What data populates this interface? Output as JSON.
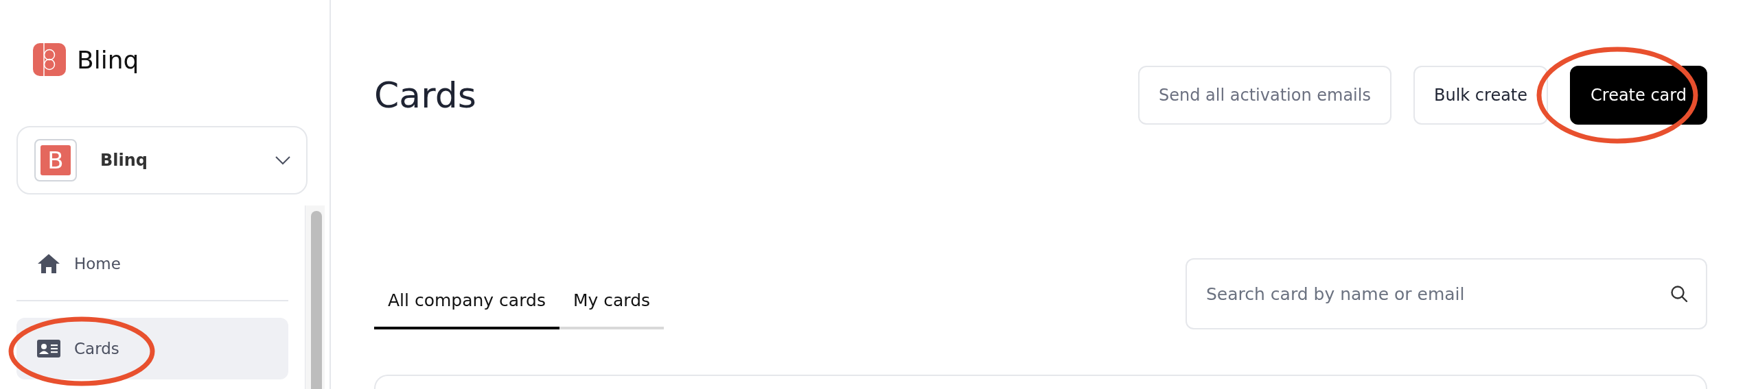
{
  "brand": {
    "name": "Blinq"
  },
  "workspace": {
    "name": "Blinq",
    "initial": "B"
  },
  "nav": [
    {
      "label": "Home",
      "kind": "home",
      "selected": false,
      "circled": false
    },
    {
      "label": "Cards",
      "kind": "cards",
      "selected": true,
      "circled": true
    }
  ],
  "page": {
    "title": "Cards"
  },
  "actions": [
    {
      "label": "Send all activation emails",
      "kind": "muted",
      "circled": false
    },
    {
      "label": "Bulk create",
      "kind": "outline",
      "circled": false
    },
    {
      "label": "Create card",
      "kind": "primary",
      "circled": true
    }
  ],
  "tabs": [
    {
      "label": "All company cards",
      "selected": true
    },
    {
      "label": "My cards",
      "selected": false
    }
  ],
  "search": {
    "placeholder": "Search card by name or email"
  }
}
